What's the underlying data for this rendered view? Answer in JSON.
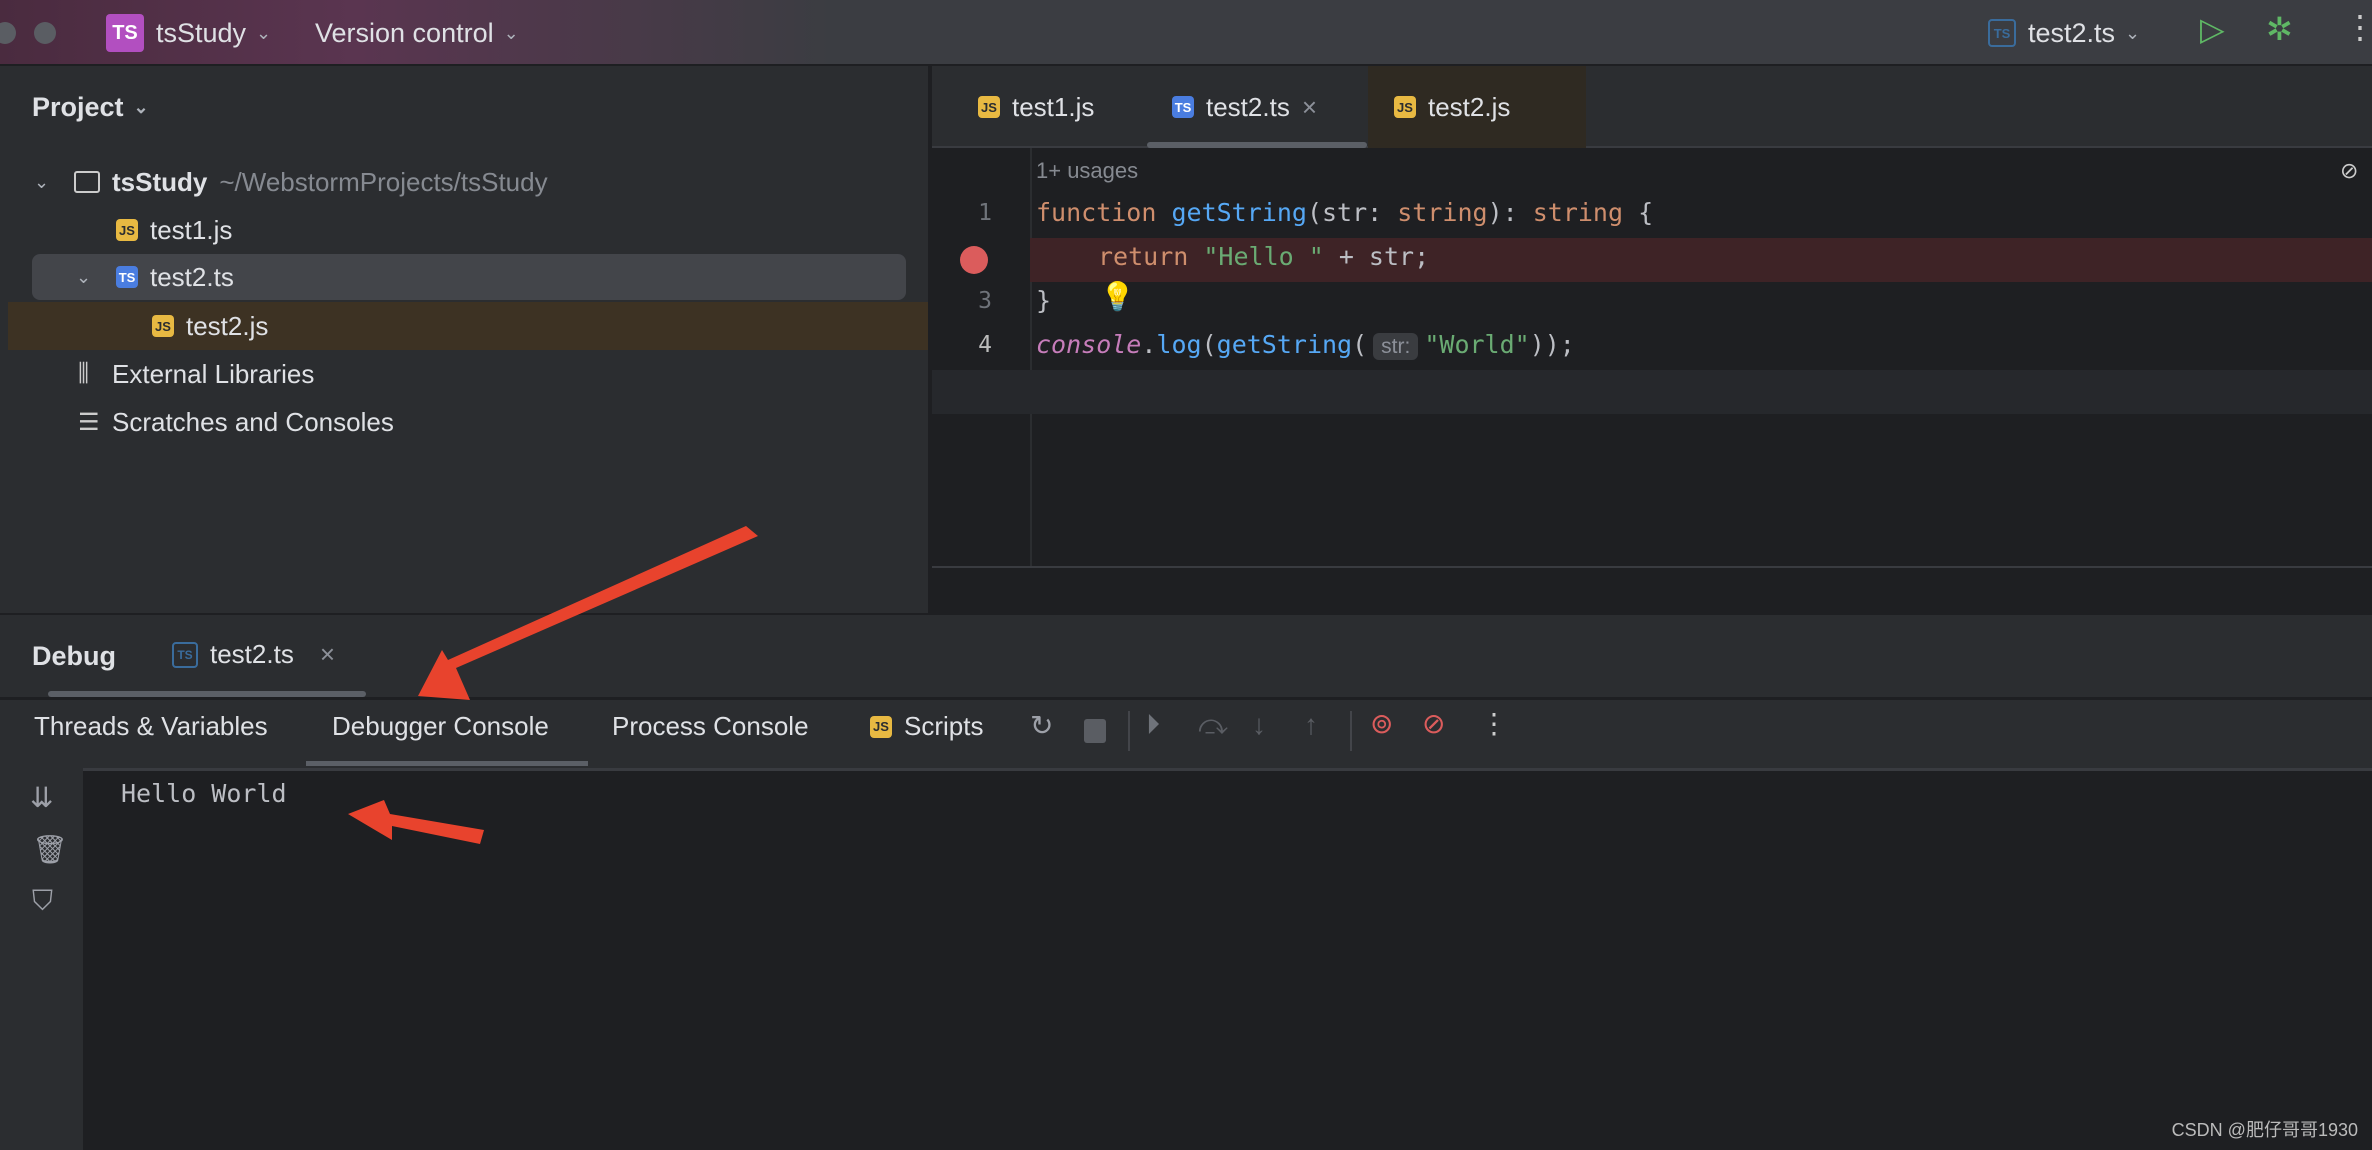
{
  "titlebar": {
    "project_badge": "TS",
    "project": "tsStudy",
    "vcs": "Version control",
    "run_config": "test2.ts",
    "run_config_badge": "TS"
  },
  "project_panel": {
    "title": "Project",
    "items": [
      {
        "label": "tsStudy",
        "path": "~/WebstormProjects/tsStudy",
        "type": "folder"
      },
      {
        "label": "test1.js",
        "type": "js"
      },
      {
        "label": "test2.ts",
        "type": "ts"
      },
      {
        "label": "test2.js",
        "type": "js"
      },
      {
        "label": "External Libraries",
        "type": "library"
      },
      {
        "label": "Scratches and Consoles",
        "type": "scratches"
      }
    ]
  },
  "editor": {
    "tabs": [
      {
        "label": "test1.js",
        "badge": "JS"
      },
      {
        "label": "test2.ts",
        "badge": "TS",
        "active": true
      },
      {
        "label": "test2.js",
        "badge": "JS"
      }
    ],
    "usages": "1+ usages",
    "line_numbers": [
      "1",
      "",
      "3",
      "4"
    ],
    "code": {
      "l1_kw": "function ",
      "l1_fn": "getString",
      "l1_a": "(str: ",
      "l1_t1": "string",
      "l1_b": "): ",
      "l1_t2": "string",
      "l1_c": " {",
      "l2_kw": "return ",
      "l2_str": "\"Hello \"",
      "l2_rest": " + str;",
      "l3": "}",
      "l4_con": "console",
      "l4_dot": ".",
      "l4_log": "log",
      "l4_p": "(",
      "l4_fn": "getString",
      "l4_p2": "(",
      "l4_hint": "str:",
      "l4_str": "\"World\"",
      "l4_end": "));"
    }
  },
  "debug": {
    "title": "Debug",
    "session": "test2.ts",
    "session_badge": "TS",
    "tabs": [
      "Threads & Variables",
      "Debugger Console",
      "Process Console",
      "Scripts"
    ],
    "active_tab": "Debugger Console",
    "scripts_badge": "JS",
    "output": "Hello World"
  },
  "watermark": "CSDN @肥仔哥哥1930",
  "colors": {
    "accent_arrow": "#e8432d",
    "breakpoint": "#db5c5c",
    "breakpoint_line": "#3e2326"
  }
}
